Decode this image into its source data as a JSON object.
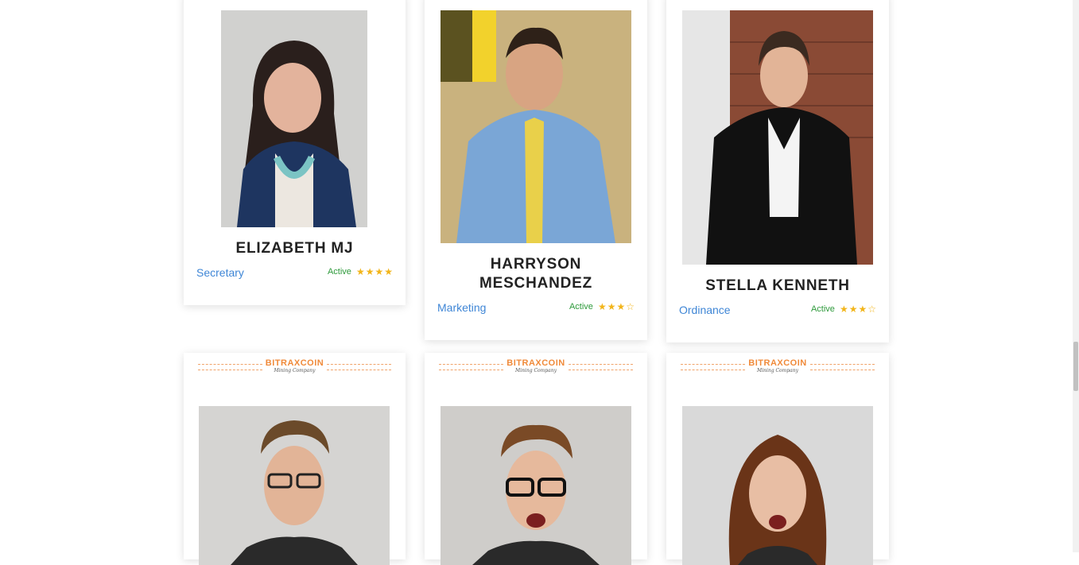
{
  "team_cards": [
    {
      "name": "ELIZABETH MJ",
      "role": "Secretary",
      "status": "Active",
      "rating": 4,
      "max_rating": 4
    },
    {
      "name": "HARRYSON MESCHANDEZ",
      "role": "Marketing",
      "status": "Active",
      "rating": 3,
      "max_rating": 4
    },
    {
      "name": "STELLA KENNETH",
      "role": "Ordinance",
      "status": "Active",
      "rating": 3,
      "max_rating": 4
    }
  ],
  "logo": {
    "main": "BITRAXCOIN",
    "sub": "Mining Company"
  },
  "colors": {
    "role_link": "#3f86d6",
    "status": "#2e9a3b",
    "star": "#f2b51a",
    "logo": "#f08a3a"
  }
}
